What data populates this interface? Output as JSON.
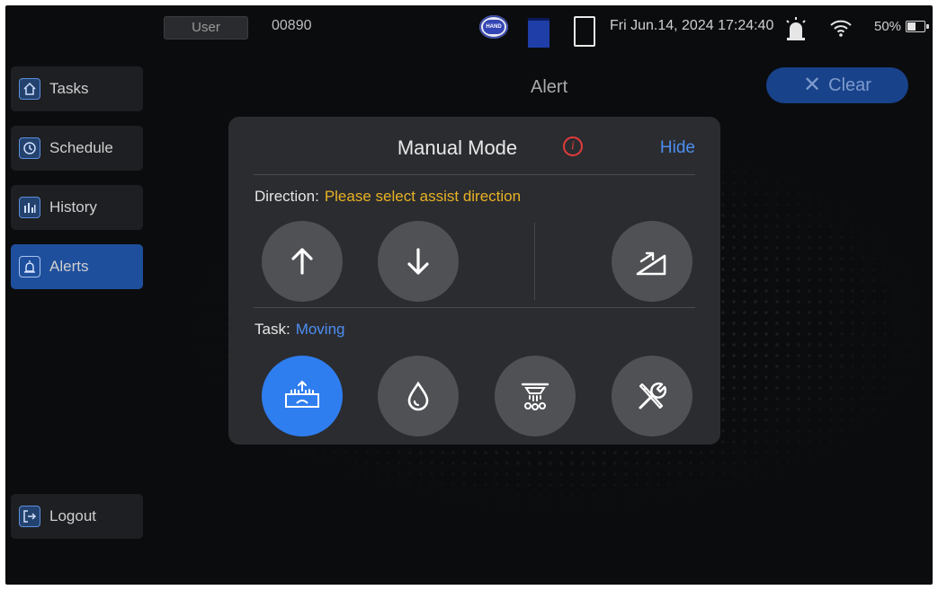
{
  "status_bar": {
    "user_label": "User",
    "user_code": "00890",
    "mode_badge": "HAND",
    "datetime": "Fri Jun.14, 2024 17:24:40",
    "battery": "50%",
    "icons": [
      "hand-mode-icon",
      "blue-status-icon",
      "tablet-icon",
      "alarm-icon",
      "wifi-icon",
      "battery-icon"
    ]
  },
  "sidebar": {
    "items": [
      {
        "label": "Tasks",
        "icon": "home-icon"
      },
      {
        "label": "Schedule",
        "icon": "clock-icon"
      },
      {
        "label": "History",
        "icon": "bar-chart-icon"
      },
      {
        "label": "Alerts",
        "icon": "alarm-icon",
        "active": true
      }
    ],
    "logout": {
      "label": "Logout",
      "icon": "logout-icon"
    }
  },
  "page": {
    "title": "Alert",
    "clear_label": "Clear"
  },
  "modal": {
    "title": "Manual Mode",
    "hide_label": "Hide",
    "direction_label": "Direction:",
    "direction_value": "Please select assist direction",
    "task_label": "Task:",
    "task_value": "Moving",
    "direction_buttons": [
      "arrow-up-icon",
      "arrow-down-icon",
      "incline-icon"
    ],
    "task_buttons": [
      {
        "icon": "moving-hands-icon",
        "active": true
      },
      {
        "icon": "water-drop-icon"
      },
      {
        "icon": "shower-icon"
      },
      {
        "icon": "tools-icon"
      }
    ]
  },
  "colors": {
    "accent_blue": "#2f7ef0",
    "warning_yellow": "#e8b224",
    "info_red": "#e33b3b",
    "modal_bg": "#2b2c30"
  }
}
